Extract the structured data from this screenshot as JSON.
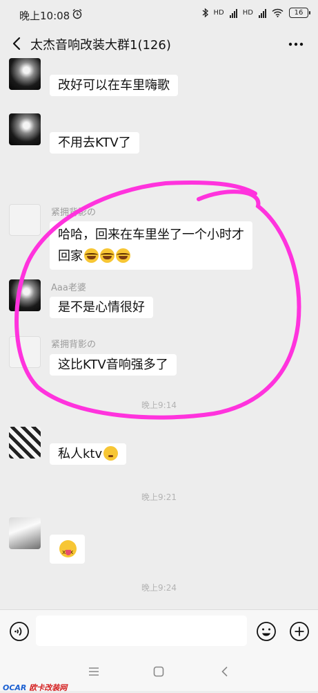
{
  "status_bar": {
    "time": "晚上10:08",
    "battery": "16",
    "network_labels": [
      "HD",
      "HD"
    ]
  },
  "chat": {
    "title": "太杰音响改装大群1(126)"
  },
  "messages": [
    {
      "sender": "",
      "text": "改好可以在车里嗨歌"
    },
    {
      "sender": "",
      "text": "不用去KTV了"
    },
    {
      "sender": "紧拥背影の",
      "text": "哈哈，回来在车里坐了一个小时才",
      "text2": "回家",
      "emojis": [
        "laugh-cry",
        "laugh-cry",
        "laugh-cry"
      ]
    },
    {
      "sender": "Aaa老婆",
      "text": "是不是心情很好"
    },
    {
      "sender": "紧拥背影の",
      "text": "这比KTV音响强多了"
    },
    {
      "sender": "",
      "text": "私人ktv",
      "emojis": [
        "thinking"
      ]
    },
    {
      "sender": "",
      "text": "",
      "emojis": [
        "tongue-out"
      ]
    }
  ],
  "timestamps": [
    "晚上9:14",
    "晚上9:21",
    "晚上9:24"
  ],
  "annotation": {
    "color": "#ff33dd"
  },
  "watermark": {
    "part1": "OCAR",
    "part2": "欧卡改装网"
  },
  "icons": {
    "alarm": "alarm-clock-icon",
    "bluetooth": "bluetooth-icon",
    "wifi": "wifi-icon",
    "back": "chevron-left-icon",
    "more": "more-dots-icon",
    "voice": "voice-input-icon",
    "emoji": "smiley-icon",
    "plus": "plus-circle-icon"
  },
  "colors": {
    "background": "#ededed",
    "bubble": "#ffffff"
  }
}
